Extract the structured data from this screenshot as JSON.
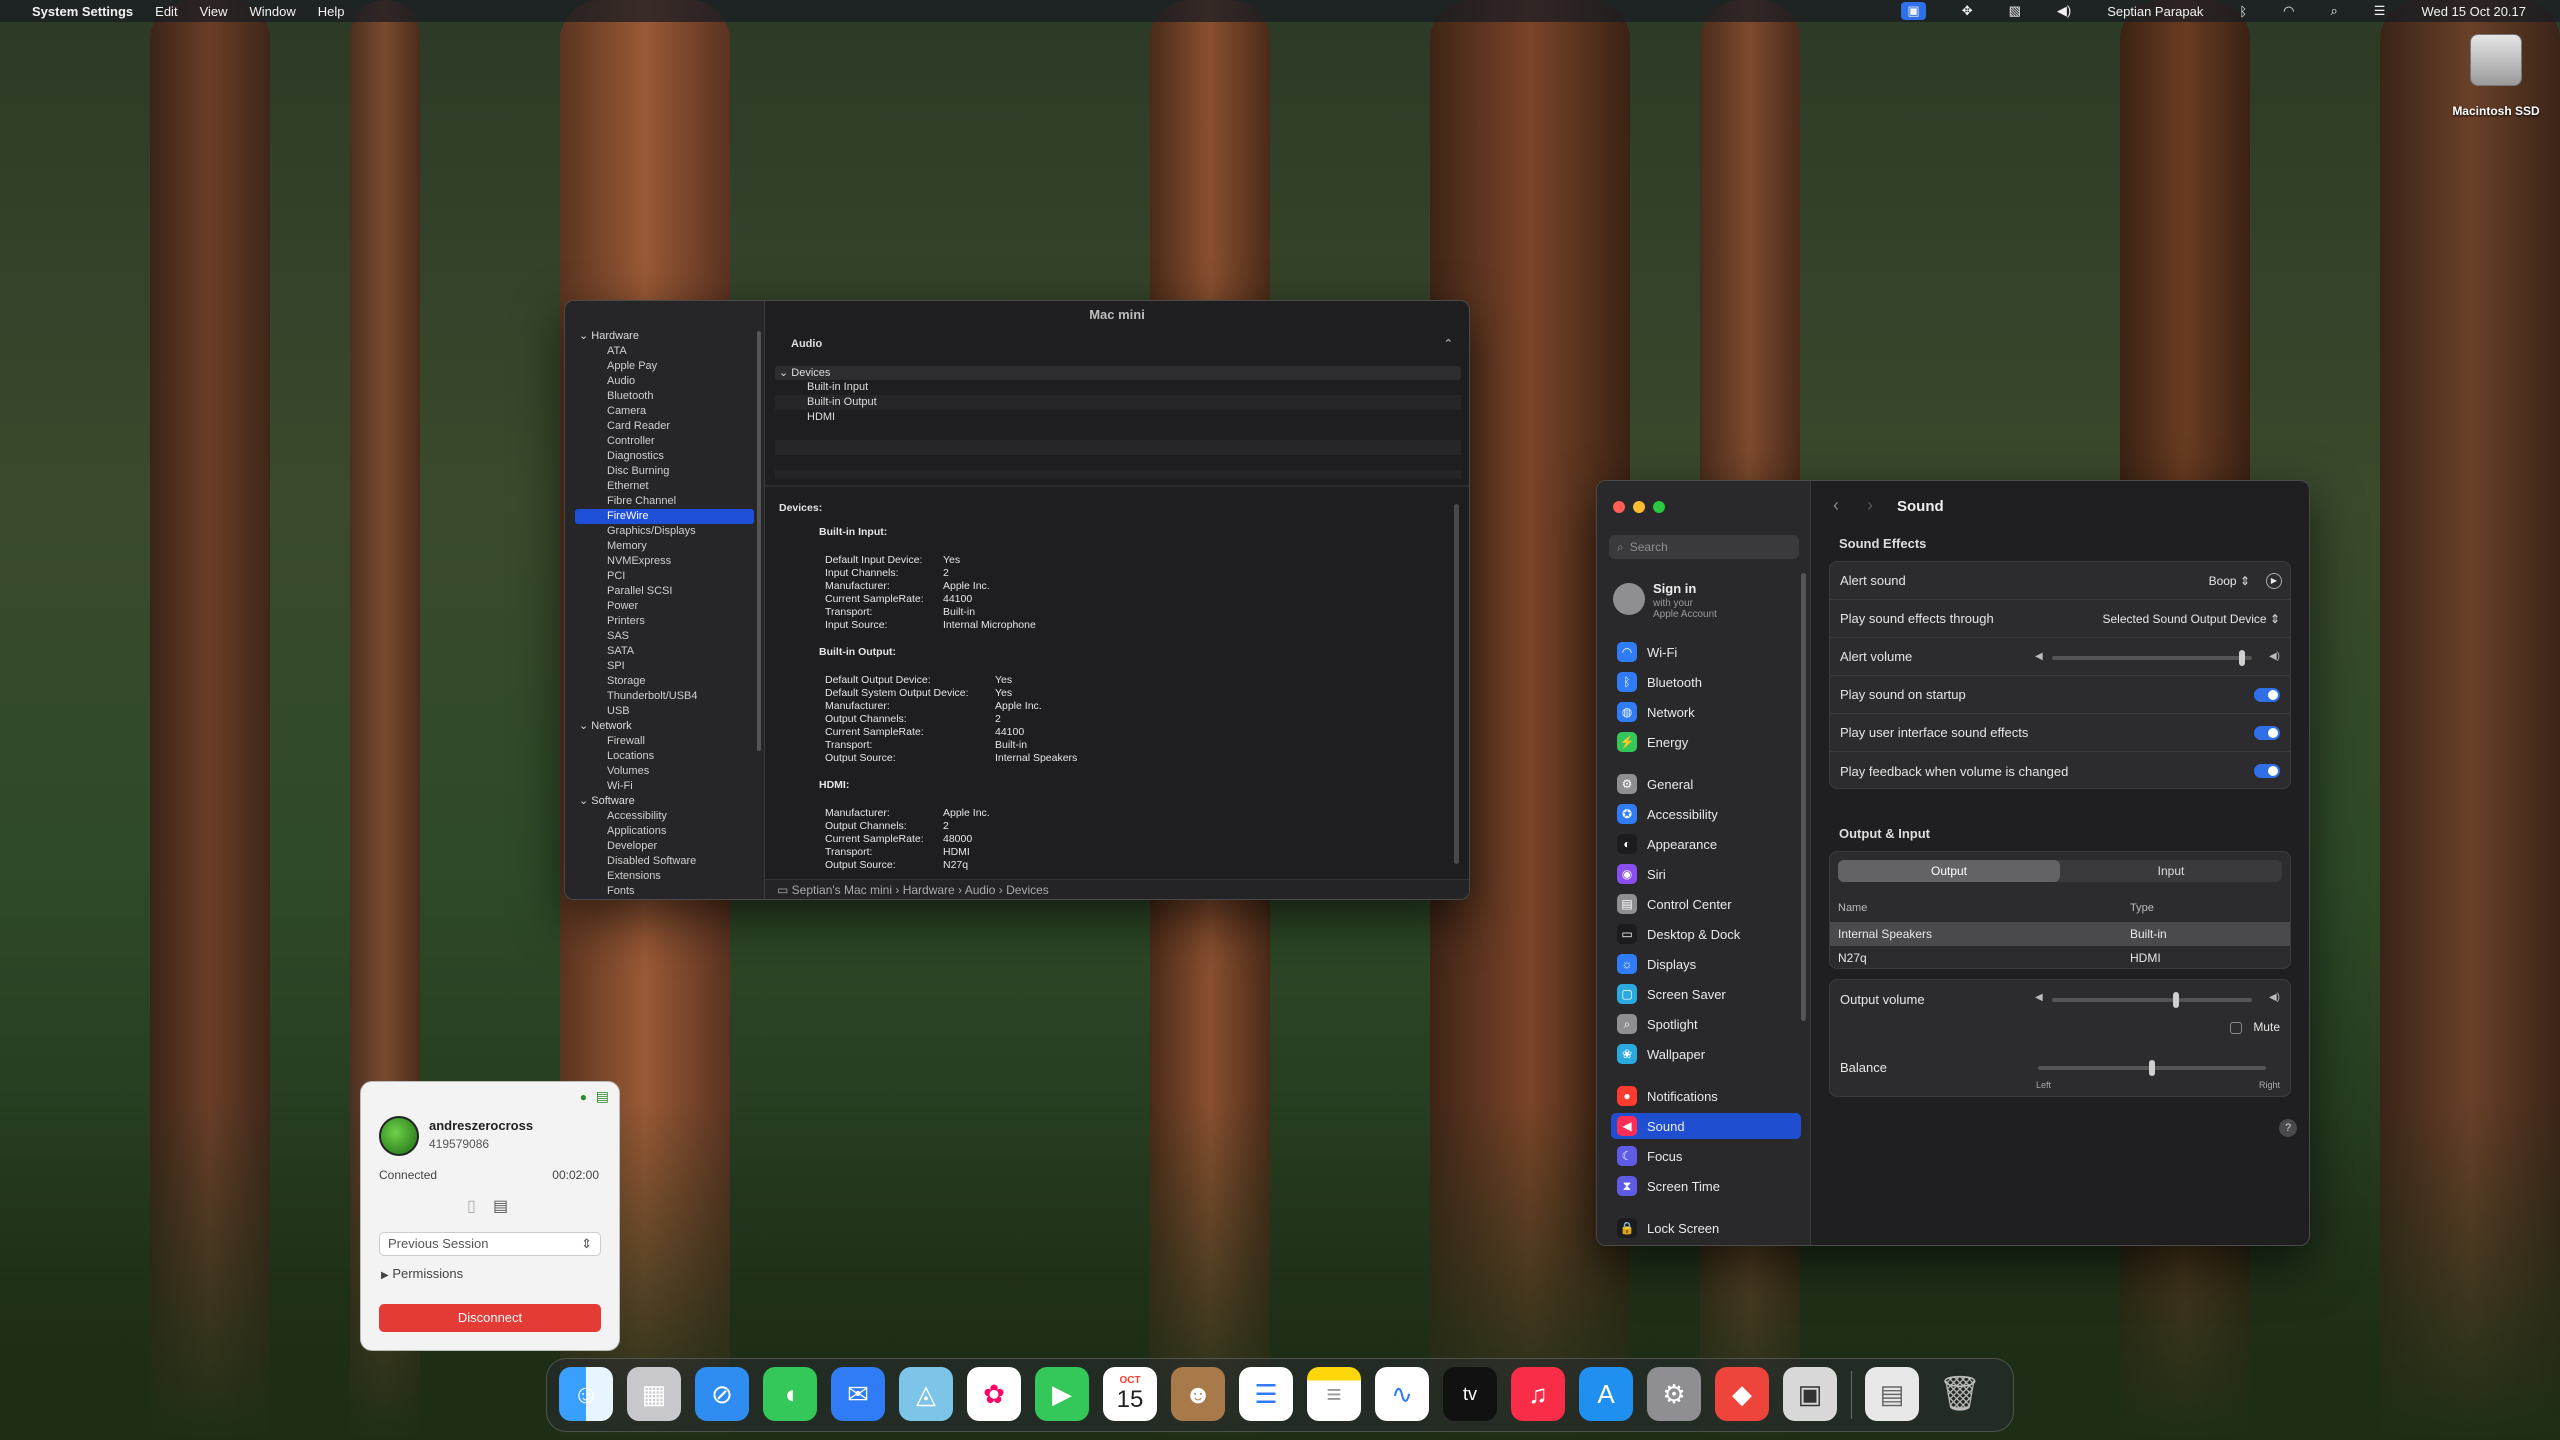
{
  "menubar": {
    "app": "System Settings",
    "items": [
      "Edit",
      "View",
      "Window",
      "Help"
    ],
    "user": "Septian Parapak",
    "datetime": "Wed 15 Oct  20.17"
  },
  "desktop": {
    "drive_label": "Macintosh SSD"
  },
  "sysinfo": {
    "title": "Mac mini",
    "sidebar": [
      {
        "label": "Hardware",
        "kind": "h"
      },
      {
        "label": "ATA",
        "kind": "c"
      },
      {
        "label": "Apple Pay",
        "kind": "c"
      },
      {
        "label": "Audio",
        "kind": "c"
      },
      {
        "label": "Bluetooth",
        "kind": "c"
      },
      {
        "label": "Camera",
        "kind": "c"
      },
      {
        "label": "Card Reader",
        "kind": "c"
      },
      {
        "label": "Controller",
        "kind": "c"
      },
      {
        "label": "Diagnostics",
        "kind": "c"
      },
      {
        "label": "Disc Burning",
        "kind": "c"
      },
      {
        "label": "Ethernet",
        "kind": "c"
      },
      {
        "label": "Fibre Channel",
        "kind": "c"
      },
      {
        "label": "FireWire",
        "kind": "c",
        "selected": true
      },
      {
        "label": "Graphics/Displays",
        "kind": "c"
      },
      {
        "label": "Memory",
        "kind": "c"
      },
      {
        "label": "NVMExpress",
        "kind": "c"
      },
      {
        "label": "PCI",
        "kind": "c"
      },
      {
        "label": "Parallel SCSI",
        "kind": "c"
      },
      {
        "label": "Power",
        "kind": "c"
      },
      {
        "label": "Printers",
        "kind": "c"
      },
      {
        "label": "SAS",
        "kind": "c"
      },
      {
        "label": "SATA",
        "kind": "c"
      },
      {
        "label": "SPI",
        "kind": "c"
      },
      {
        "label": "Storage",
        "kind": "c"
      },
      {
        "label": "Thunderbolt/USB4",
        "kind": "c"
      },
      {
        "label": "USB",
        "kind": "c"
      },
      {
        "label": "Network",
        "kind": "h"
      },
      {
        "label": "Firewall",
        "kind": "c"
      },
      {
        "label": "Locations",
        "kind": "c"
      },
      {
        "label": "Volumes",
        "kind": "c"
      },
      {
        "label": "Wi-Fi",
        "kind": "c"
      },
      {
        "label": "Software",
        "kind": "h"
      },
      {
        "label": "Accessibility",
        "kind": "c"
      },
      {
        "label": "Applications",
        "kind": "c"
      },
      {
        "label": "Developer",
        "kind": "c"
      },
      {
        "label": "Disabled Software",
        "kind": "c"
      },
      {
        "label": "Extensions",
        "kind": "c"
      },
      {
        "label": "Fonts",
        "kind": "c"
      }
    ],
    "section_header": "Audio",
    "list_header": "Devices",
    "list_items": [
      "Built-in Input",
      "Built-in Output",
      "HDMI"
    ],
    "detail_title": "Devices:",
    "groups": [
      {
        "title": "Built-in Input:",
        "rows": [
          [
            "Default Input Device:",
            "Yes"
          ],
          [
            "Input Channels:",
            "2"
          ],
          [
            "Manufacturer:",
            "Apple Inc."
          ],
          [
            "Current SampleRate:",
            "44100"
          ],
          [
            "Transport:",
            "Built-in"
          ],
          [
            "Input Source:",
            "Internal Microphone"
          ]
        ]
      },
      {
        "title": "Built-in Output:",
        "rows": [
          [
            "Default Output Device:",
            "Yes"
          ],
          [
            "Default System Output Device:",
            "Yes"
          ],
          [
            "Manufacturer:",
            "Apple Inc."
          ],
          [
            "Output Channels:",
            "2"
          ],
          [
            "Current SampleRate:",
            "44100"
          ],
          [
            "Transport:",
            "Built-in"
          ],
          [
            "Output Source:",
            "Internal Speakers"
          ]
        ]
      },
      {
        "title": "HDMI:",
        "rows": [
          [
            "Manufacturer:",
            "Apple Inc."
          ],
          [
            "Output Channels:",
            "2"
          ],
          [
            "Current SampleRate:",
            "48000"
          ],
          [
            "Transport:",
            "HDMI"
          ],
          [
            "Output Source:",
            "N27q"
          ]
        ]
      }
    ],
    "path": [
      "Septian's Mac mini",
      "Hardware",
      "Audio",
      "Devices"
    ]
  },
  "settings": {
    "search_placeholder": "Search",
    "signin": {
      "title": "Sign in",
      "sub1": "with your",
      "sub2": "Apple Account"
    },
    "sidebar": [
      {
        "label": "Wi-Fi",
        "color": "#2f7cf6",
        "icon": "wifi-icon",
        "glyph": "◠"
      },
      {
        "label": "Bluetooth",
        "color": "#2f7cf6",
        "icon": "bluetooth-icon",
        "glyph": "ᛒ"
      },
      {
        "label": "Network",
        "color": "#2f7cf6",
        "icon": "network-icon",
        "glyph": "◍"
      },
      {
        "label": "Energy",
        "color": "#34c759",
        "icon": "energy-icon",
        "glyph": "⚡"
      },
      {
        "label": "General",
        "color": "#8e8e93",
        "icon": "gear-icon",
        "glyph": "⚙"
      },
      {
        "label": "Accessibility",
        "color": "#2f7cf6",
        "icon": "accessibility-icon",
        "glyph": "✪"
      },
      {
        "label": "Appearance",
        "color": "#1c1c1e",
        "icon": "appearance-icon",
        "glyph": "◐"
      },
      {
        "label": "Siri",
        "color": "#8a4ef0",
        "icon": "siri-icon",
        "glyph": "◉"
      },
      {
        "label": "Control Center",
        "color": "#8e8e93",
        "icon": "control-center-icon",
        "glyph": "▤"
      },
      {
        "label": "Desktop & Dock",
        "color": "#1c1c1e",
        "icon": "dock-icon",
        "glyph": "▭"
      },
      {
        "label": "Displays",
        "color": "#2f7cf6",
        "icon": "displays-icon",
        "glyph": "☼"
      },
      {
        "label": "Screen Saver",
        "color": "#2aa9e0",
        "icon": "screen-saver-icon",
        "glyph": "▢"
      },
      {
        "label": "Spotlight",
        "color": "#8e8e93",
        "icon": "spotlight-icon",
        "glyph": "⌕"
      },
      {
        "label": "Wallpaper",
        "color": "#2aa9e0",
        "icon": "wallpaper-icon",
        "glyph": "❀"
      },
      {
        "label": "Notifications",
        "color": "#ff3b30",
        "icon": "notifications-icon",
        "glyph": "●"
      },
      {
        "label": "Sound",
        "color": "#ff2d55",
        "icon": "sound-icon",
        "glyph": "◀",
        "selected": true
      },
      {
        "label": "Focus",
        "color": "#5e5ce6",
        "icon": "focus-icon",
        "glyph": "☾"
      },
      {
        "label": "Screen Time",
        "color": "#5e5ce6",
        "icon": "screen-time-icon",
        "glyph": "⧗"
      },
      {
        "label": "Lock Screen",
        "color": "#1c1c1e",
        "icon": "lock-icon",
        "glyph": "🔒"
      }
    ],
    "page_title": "Sound",
    "effects_header": "Sound Effects",
    "alert_sound_label": "Alert sound",
    "alert_sound_value": "Boop",
    "play_through_label": "Play sound effects through",
    "play_through_value": "Selected Sound Output Device",
    "alert_volume_label": "Alert volume",
    "alert_volume_level": 0.95,
    "startup_label": "Play sound on startup",
    "ui_effects_label": "Play user interface sound effects",
    "feedback_label": "Play feedback when volume is changed",
    "io_header": "Output & Input",
    "tabs": [
      "Output",
      "Input"
    ],
    "columns": [
      "Name",
      "Type"
    ],
    "devices": [
      [
        "Internal Speakers",
        "Built-in"
      ],
      [
        "N27q",
        "HDMI"
      ]
    ],
    "output_volume_label": "Output volume",
    "output_volume_level": 0.62,
    "mute_label": "Mute",
    "balance_label": "Balance",
    "balance_left": "Left",
    "balance_right": "Right",
    "balance_level": 0.5,
    "help": "?"
  },
  "remote": {
    "name": "andreszerocross",
    "id": "419579086",
    "status": "Connected",
    "timer": "00:02:00",
    "session": "Previous Session",
    "permissions": "Permissions",
    "disconnect": "Disconnect"
  },
  "dock_date": {
    "month": "OCT",
    "day": "15"
  },
  "dock_tv": "tv"
}
